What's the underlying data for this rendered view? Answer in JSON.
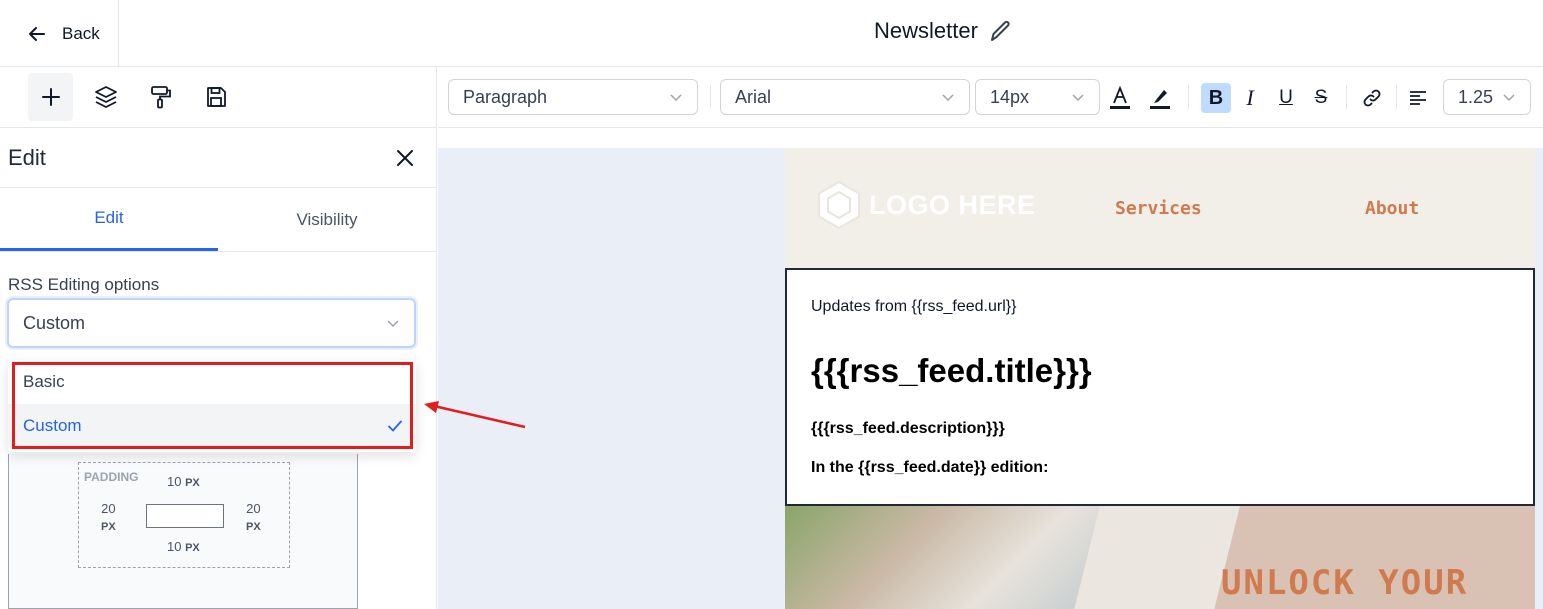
{
  "header": {
    "back_label": "Back",
    "title": "Newsletter"
  },
  "left_panel": {
    "tools": [
      "plus-icon",
      "layers-icon",
      "paint-roller-icon",
      "save-icon"
    ],
    "edit_title": "Edit",
    "tabs": [
      {
        "label": "Edit",
        "active": true
      },
      {
        "label": "Visibility",
        "active": false
      }
    ],
    "rss_label": "RSS Editing options",
    "rss_selected": "Custom",
    "rss_options": [
      {
        "label": "Basic",
        "selected": false
      },
      {
        "label": "Custom",
        "selected": true
      }
    ],
    "padding": {
      "label": "PADDING",
      "top": "10",
      "bottom": "10",
      "left": "20",
      "right": "20",
      "unit": "PX"
    }
  },
  "format_toolbar": {
    "block_type": "Paragraph",
    "font_family": "Arial",
    "font_size": "14px",
    "line_height": "1.25",
    "bold_active": true
  },
  "email": {
    "logo_text": "LOGO HERE",
    "nav": [
      "Services",
      "About"
    ],
    "rss_lines": {
      "updates": "Updates from {{rss_feed.url}}",
      "title": "{{{rss_feed.title}}}",
      "description": "{{{rss_feed.description}}}",
      "edition": "In the {{rss_feed.date}} edition:"
    },
    "hero_text": "UNLOCK YOUR"
  },
  "colors": {
    "accent": "#2563eb",
    "highlight_red": "#e11d1d",
    "brand_orange": "#d07b4f",
    "canvas_bg": "#eaeff7"
  }
}
